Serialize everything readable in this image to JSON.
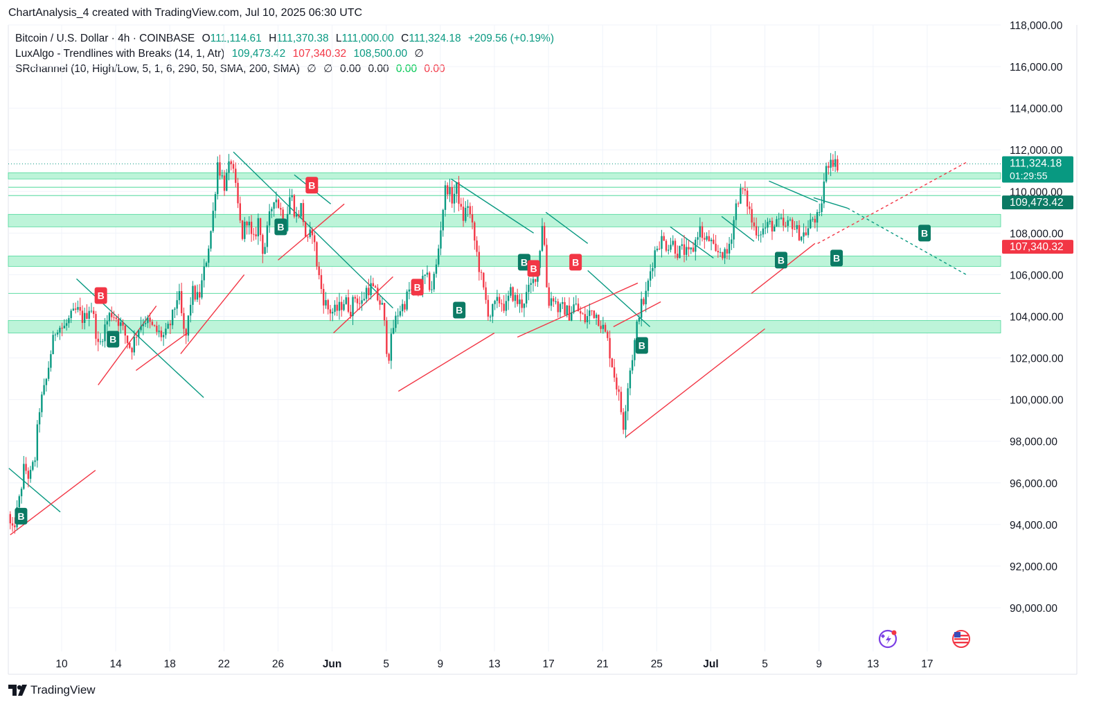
{
  "header": {
    "title": "ChartAnalysis_4 created with TradingView.com, Jul 10, 2025 06:30 UTC"
  },
  "legend": {
    "main": {
      "symbol": "Bitcoin / U.S. Dollar · 4h · COINBASE",
      "o_label": "O",
      "o": "111,114.61",
      "h_label": "H",
      "h": "111,370.38",
      "l_label": "L",
      "l": "111,000.00",
      "c_label": "C",
      "c": "111,324.18",
      "change": "+209.56 (+0.19%)"
    },
    "luxalgo": {
      "name": "LuxAlgo - Trendlines with Breaks (14, 1, Atr)",
      "v1": "109,473.42",
      "v2": "107,340.32",
      "v3": "108,500.00",
      "v4": "∅"
    },
    "srchannel": {
      "name": "SRchannel (10, High/Low, 5, 1, 6, 290, 50, SMA, 200, SMA)",
      "v1": "∅",
      "v2": "∅",
      "v3": "0.00",
      "v4": "0.00",
      "v5": "0.00",
      "v6": "0.00"
    }
  },
  "footer": {
    "brand": "TradingView"
  },
  "colors": {
    "up": "#089981",
    "down": "#f23645",
    "zone": "#b2f2d2",
    "zone_line": "#4cd89a",
    "resistance_line": "#089981",
    "support_line": "#f23645",
    "grid": "#f0f3fa"
  },
  "price_labels": [
    {
      "value": 111324.18,
      "text": "111,324.18",
      "sub": "01:29:55",
      "color": "#089981"
    },
    {
      "value": 109473.42,
      "text": "109,473.42",
      "color": "#0b7a64"
    },
    {
      "value": 107340.32,
      "text": "107,340.32",
      "color": "#f23645"
    }
  ],
  "chart_data": {
    "type": "candlestick",
    "title": "",
    "timeframe": "4h",
    "y_ticks": [
      "118,000.00",
      "116,000.00",
      "114,000.00",
      "112,000.00",
      "110,000.00",
      "108,000.00",
      "106,000.00",
      "104,000.00",
      "102,000.00",
      "100,000.00",
      "98,000.00",
      "96,000.00",
      "94,000.00",
      "92,000.00",
      "90,000.00"
    ],
    "y_tick_values": [
      118000,
      116000,
      114000,
      112000,
      110000,
      108000,
      106000,
      104000,
      102000,
      100000,
      98000,
      96000,
      94000,
      92000,
      90000
    ],
    "x_ticks": [
      "10",
      "14",
      "18",
      "22",
      "26",
      "Jun",
      "5",
      "9",
      "13",
      "17",
      "21",
      "25",
      "Jul",
      "5",
      "9",
      "13",
      "17"
    ],
    "x_tick_index": [
      0,
      4,
      8,
      12,
      16,
      20,
      24,
      28,
      32,
      36,
      40,
      44,
      48,
      52,
      56,
      60,
      64
    ],
    "ylim": [
      89000,
      118000
    ],
    "grid": true,
    "price_path": [
      [
        -3.8,
        94500
      ],
      [
        -3.5,
        93500
      ],
      [
        -3.0,
        95000
      ],
      [
        -2.6,
        96800
      ],
      [
        -2.2,
        96200
      ],
      [
        -1.8,
        97200
      ],
      [
        -1.5,
        99500
      ],
      [
        -1.0,
        100800
      ],
      [
        -0.6,
        102400
      ],
      [
        -0.2,
        103600
      ],
      [
        0.3,
        103400
      ],
      [
        0.8,
        103900
      ],
      [
        1.3,
        104300
      ],
      [
        1.8,
        103800
      ],
      [
        2.3,
        104600
      ],
      [
        2.6,
        103700
      ],
      [
        2.9,
        102400
      ],
      [
        3.3,
        103400
      ],
      [
        3.8,
        104200
      ],
      [
        4.3,
        103900
      ],
      [
        4.8,
        103200
      ],
      [
        5.3,
        102400
      ],
      [
        5.8,
        103400
      ],
      [
        6.3,
        103900
      ],
      [
        6.8,
        103500
      ],
      [
        7.3,
        103200
      ],
      [
        7.8,
        103000
      ],
      [
        8.3,
        103800
      ],
      [
        8.8,
        105200
      ],
      [
        9.3,
        102700
      ],
      [
        9.8,
        105200
      ],
      [
        10.3,
        104800
      ],
      [
        10.8,
        106500
      ],
      [
        11.3,
        108500
      ],
      [
        11.7,
        111400
      ],
      [
        12.2,
        110300
      ],
      [
        12.7,
        111500
      ],
      [
        13.1,
        109800
      ],
      [
        13.5,
        107800
      ],
      [
        13.9,
        108800
      ],
      [
        14.3,
        107400
      ],
      [
        14.7,
        108600
      ],
      [
        15.1,
        107000
      ],
      [
        15.5,
        108600
      ],
      [
        15.9,
        109900
      ],
      [
        16.3,
        109200
      ],
      [
        16.7,
        108400
      ],
      [
        17.1,
        110000
      ],
      [
        17.5,
        108700
      ],
      [
        17.9,
        109300
      ],
      [
        18.3,
        107400
      ],
      [
        18.7,
        108200
      ],
      [
        19.1,
        106200
      ],
      [
        19.5,
        104900
      ],
      [
        19.9,
        104300
      ],
      [
        20.3,
        104200
      ],
      [
        20.7,
        104400
      ],
      [
        21.1,
        104800
      ],
      [
        21.5,
        104300
      ],
      [
        21.9,
        105000
      ],
      [
        22.3,
        104500
      ],
      [
        22.7,
        105300
      ],
      [
        23.1,
        105400
      ],
      [
        23.5,
        104900
      ],
      [
        23.9,
        104400
      ],
      [
        24.3,
        101900
      ],
      [
        24.7,
        103500
      ],
      [
        25.1,
        104300
      ],
      [
        25.5,
        104600
      ],
      [
        25.9,
        105300
      ],
      [
        26.3,
        105000
      ],
      [
        26.7,
        105500
      ],
      [
        27.1,
        105900
      ],
      [
        27.5,
        105300
      ],
      [
        27.9,
        106500
      ],
      [
        28.3,
        108900
      ],
      [
        28.6,
        110400
      ],
      [
        29.0,
        109600
      ],
      [
        29.4,
        110200
      ],
      [
        29.8,
        108600
      ],
      [
        30.2,
        109400
      ],
      [
        30.6,
        108000
      ],
      [
        31.0,
        106500
      ],
      [
        31.4,
        105100
      ],
      [
        31.8,
        104000
      ],
      [
        32.2,
        104500
      ],
      [
        32.6,
        104800
      ],
      [
        33.0,
        104400
      ],
      [
        33.4,
        105200
      ],
      [
        33.8,
        104700
      ],
      [
        34.2,
        104600
      ],
      [
        34.6,
        105100
      ],
      [
        35.0,
        105600
      ],
      [
        35.4,
        106400
      ],
      [
        35.7,
        108500
      ],
      [
        35.9,
        107200
      ],
      [
        36.1,
        104600
      ],
      [
        36.5,
        105000
      ],
      [
        36.9,
        104300
      ],
      [
        37.3,
        104400
      ],
      [
        37.7,
        104100
      ],
      [
        38.1,
        104600
      ],
      [
        38.5,
        104100
      ],
      [
        38.9,
        103800
      ],
      [
        39.3,
        104300
      ],
      [
        39.7,
        104100
      ],
      [
        40.1,
        103600
      ],
      [
        40.5,
        102900
      ],
      [
        40.9,
        101600
      ],
      [
        41.3,
        100400
      ],
      [
        41.7,
        98800
      ],
      [
        42.1,
        101100
      ],
      [
        42.5,
        102600
      ],
      [
        42.9,
        104400
      ],
      [
        43.3,
        104800
      ],
      [
        43.7,
        106200
      ],
      [
        44.1,
        107300
      ],
      [
        44.5,
        107700
      ],
      [
        44.9,
        107400
      ],
      [
        45.3,
        107600
      ],
      [
        45.7,
        107100
      ],
      [
        46.1,
        107200
      ],
      [
        46.5,
        106900
      ],
      [
        46.9,
        107300
      ],
      [
        47.3,
        108300
      ],
      [
        47.7,
        107600
      ],
      [
        48.1,
        107700
      ],
      [
        48.5,
        106900
      ],
      [
        48.9,
        107200
      ],
      [
        49.3,
        106800
      ],
      [
        49.7,
        108000
      ],
      [
        50.1,
        109600
      ],
      [
        50.5,
        110100
      ],
      [
        50.9,
        109400
      ],
      [
        51.3,
        108300
      ],
      [
        51.7,
        108100
      ],
      [
        52.1,
        108200
      ],
      [
        52.5,
        108400
      ],
      [
        52.9,
        108300
      ],
      [
        53.3,
        108500
      ],
      [
        53.7,
        108200
      ],
      [
        54.1,
        108600
      ],
      [
        54.5,
        108100
      ],
      [
        54.9,
        107900
      ],
      [
        55.3,
        108100
      ],
      [
        55.7,
        108700
      ],
      [
        56.2,
        108700
      ],
      [
        56.6,
        110800
      ],
      [
        57.0,
        111700
      ],
      [
        57.4,
        111300
      ]
    ],
    "trendlines_resistance": [
      [
        [
          -3.9,
          96700
        ],
        [
          -0.1,
          94600
        ]
      ],
      [
        [
          1.1,
          105800
        ],
        [
          10.5,
          100100
        ]
      ],
      [
        [
          12.7,
          111900
        ],
        [
          24.5,
          104400
        ]
      ],
      [
        [
          17.2,
          110800
        ],
        [
          19.9,
          109400
        ]
      ],
      [
        [
          28.8,
          110600
        ],
        [
          34.9,
          108000
        ]
      ],
      [
        [
          35.8,
          109000
        ],
        [
          38.9,
          107500
        ]
      ],
      [
        [
          38.9,
          106200
        ],
        [
          43.5,
          103500
        ]
      ],
      [
        [
          45.0,
          108300
        ],
        [
          48.2,
          106800
        ]
      ],
      [
        [
          48.8,
          108800
        ],
        [
          51.2,
          107600
        ]
      ],
      [
        [
          52.3,
          110500
        ],
        [
          55.9,
          109500
        ]
      ],
      [
        [
          55.6,
          109700
        ],
        [
          58.1,
          109200
        ]
      ]
    ],
    "trendlines_support": [
      [
        [
          -3.8,
          93500
        ],
        [
          2.5,
          96600
        ]
      ],
      [
        [
          2.7,
          100700
        ],
        [
          7.0,
          104500
        ]
      ],
      [
        [
          5.5,
          101400
        ],
        [
          9.3,
          103200
        ]
      ],
      [
        [
          8.8,
          102200
        ],
        [
          13.5,
          106000
        ]
      ],
      [
        [
          16.0,
          106700
        ],
        [
          20.9,
          109400
        ]
      ],
      [
        [
          20.1,
          103200
        ],
        [
          24.5,
          105900
        ]
      ],
      [
        [
          24.9,
          100400
        ],
        [
          32.0,
          103200
        ]
      ],
      [
        [
          33.7,
          103000
        ],
        [
          42.6,
          105600
        ]
      ],
      [
        [
          40.8,
          103500
        ],
        [
          44.3,
          104700
        ]
      ],
      [
        [
          41.7,
          98200
        ],
        [
          52.0,
          103400
        ]
      ],
      [
        [
          51.0,
          105100
        ],
        [
          55.7,
          107500
        ]
      ]
    ],
    "extension_support": [
      [
        55.9,
        107500
      ],
      [
        66.9,
        111400
      ]
    ],
    "extension_resistance": [
      [
        58.1,
        109200
      ],
      [
        66.9,
        106000
      ]
    ],
    "sr_zones": [
      [
        110600,
        110900
      ],
      [
        108300,
        108900
      ],
      [
        106400,
        106900
      ],
      [
        103200,
        103800
      ]
    ],
    "sr_lines": [
      109800,
      110200,
      105100
    ],
    "current_price_line": 111324.18,
    "signals": [
      {
        "label": "B",
        "type": "buy",
        "x": -3.0,
        "y": 94400
      },
      {
        "label": "B",
        "type": "sell",
        "x": 2.9,
        "y": 105000
      },
      {
        "label": "B",
        "type": "buy",
        "x": 3.8,
        "y": 102900
      },
      {
        "label": "B",
        "type": "buy",
        "x": 16.2,
        "y": 108300
      },
      {
        "label": "B",
        "type": "sell",
        "x": 18.5,
        "y": 110300
      },
      {
        "label": "B",
        "type": "sell",
        "x": 26.3,
        "y": 105400
      },
      {
        "label": "B",
        "type": "buy",
        "x": 29.4,
        "y": 104300
      },
      {
        "label": "B",
        "type": "buy",
        "x": 34.2,
        "y": 106600
      },
      {
        "label": "B",
        "type": "sell",
        "x": 34.9,
        "y": 106300
      },
      {
        "label": "B",
        "type": "sell",
        "x": 38.0,
        "y": 106600
      },
      {
        "label": "B",
        "type": "buy",
        "x": 42.9,
        "y": 102600
      },
      {
        "label": "B",
        "type": "buy",
        "x": 53.2,
        "y": 106700
      },
      {
        "label": "B",
        "type": "buy",
        "x": 57.3,
        "y": 106800
      },
      {
        "label": "B",
        "type": "buy",
        "x": 63.8,
        "y": 108000
      }
    ]
  }
}
